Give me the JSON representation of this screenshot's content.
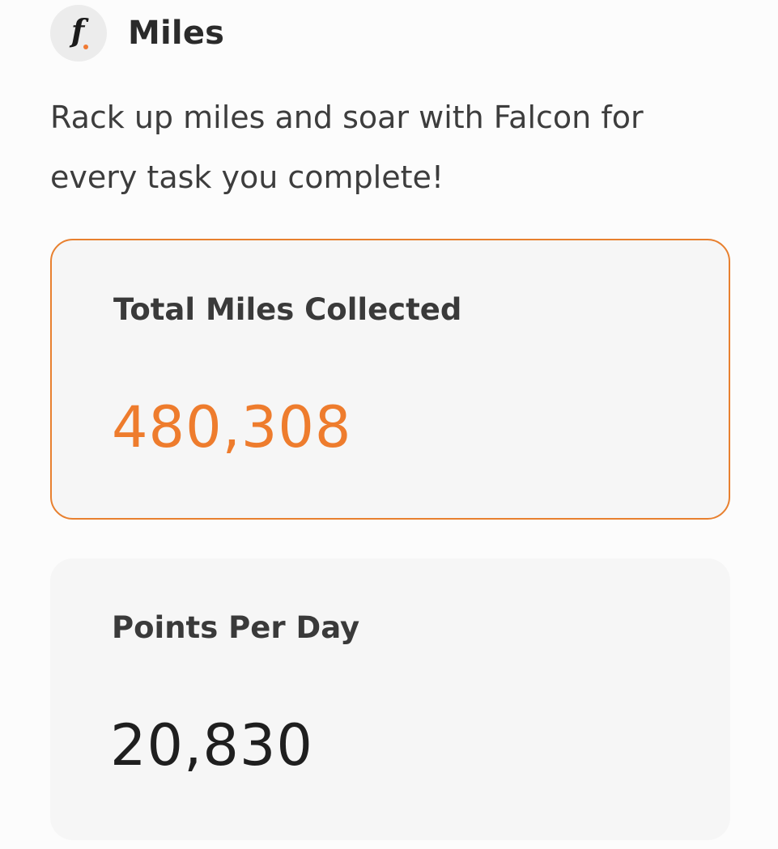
{
  "header": {
    "logo_icon": "falcon-f-logo-icon",
    "logo_letter": "f",
    "title": "Miles"
  },
  "description": "Rack up miles and soar with Falcon for every task you complete!",
  "cards": {
    "total_miles": {
      "label": "Total Miles Collected",
      "value": "480,308"
    },
    "points_per_day": {
      "label": "Points Per Day",
      "value": "20,830"
    }
  },
  "colors": {
    "accent": "#ee7c2d",
    "card_background": "#f6f6f6",
    "text_primary": "#3a3a3a"
  }
}
